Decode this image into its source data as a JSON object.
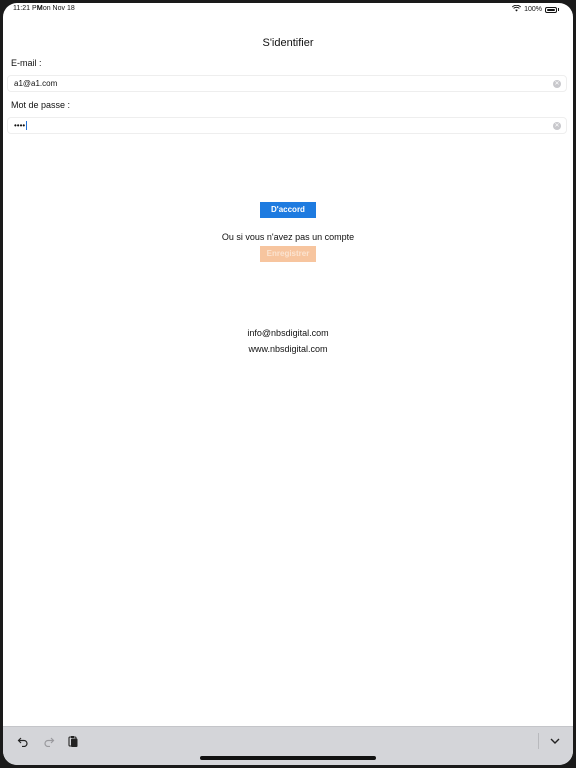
{
  "status_bar": {
    "time": "11:21 PM",
    "date": "Mon Nov 18",
    "battery": "100%"
  },
  "title": "S'identifier",
  "email": {
    "label": "E-mail :",
    "value": "a1@a1.com"
  },
  "password": {
    "label": "Mot de passe :",
    "value": "••••"
  },
  "buttons": {
    "ok": "D'accord",
    "register": "Enregistrer"
  },
  "register_prompt": "Ou si vous n'avez pas un compte",
  "contact": {
    "email": "info@nbsdigital.com",
    "website": "www.nbsdigital.com"
  },
  "colors": {
    "primary": "#1e7be0",
    "register_disabled": "#f7c59f"
  },
  "icons": {
    "toolbar": [
      "undo-icon",
      "redo-icon",
      "paste-icon",
      "dismiss-keyboard-icon"
    ],
    "field": "clear-icon"
  }
}
